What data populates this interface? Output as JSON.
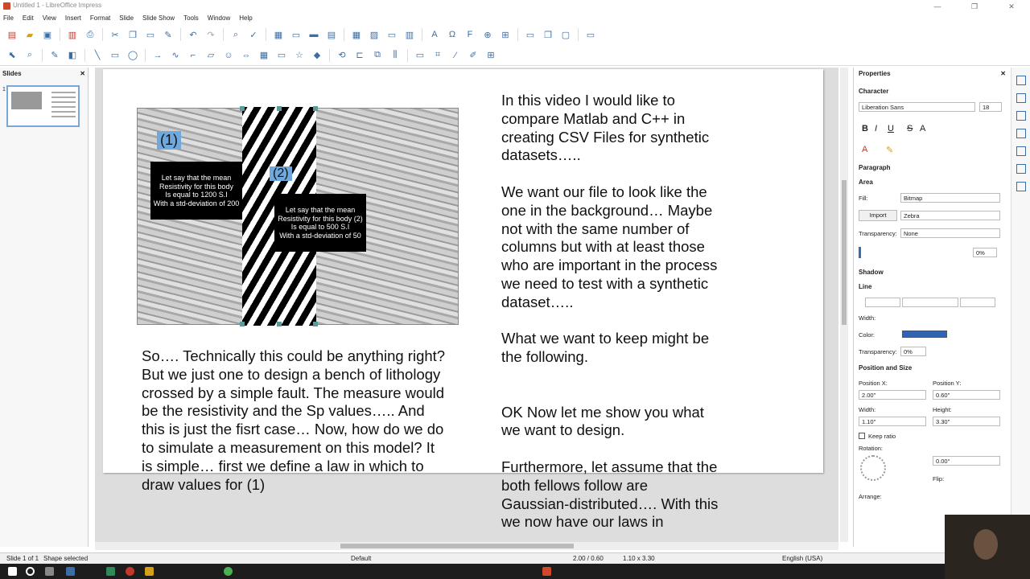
{
  "window": {
    "title": "Untitled 1 - LibreOffice Impress",
    "min": "—",
    "max": "❐",
    "close": "✕"
  },
  "menu": [
    "File",
    "Edit",
    "View",
    "Insert",
    "Format",
    "Slide",
    "Slide Show",
    "Tools",
    "Window",
    "Help"
  ],
  "slides_pane": {
    "title": "Slides",
    "close": "✕",
    "thumb_number": "1"
  },
  "slide": {
    "label1": "(1)",
    "label2": "(2)",
    "box1": [
      "Let say that the mean",
      "Resistivity for this body",
      "Is equal to 1200 S.I",
      "With a std-deviation of 200"
    ],
    "box2": [
      "Let say that the mean",
      "Resistivity for this body (2)",
      "Is equal to 500 S.I",
      "With a std-deviation of 50"
    ],
    "text_left": "So…. Technically this could be anything right? But we just one to design a bench of lithology crossed by a simple fault. The measure would be the resistivity and the Sp values….. And this is just the fisrt case… Now, how do we do to simulate a measurement on this model? It is simple… first we define a law in which to draw values for (1)",
    "text_right": "In this video I would like to compare Matlab and C++ in creating CSV Files for synthetic datasets…..\n\nWe want our file to look like the one in the background… Maybe not with the same number of columns but with at least those who are important in the process we need to test with a synthetic dataset…..\n\nWhat we want to keep might be the following.\n\n\nOK Now let me show you what we want to design.\n\nFurthermore, let assume that the both fellows follow are Gaussian-distributed…. With this we now have our laws in"
  },
  "properties": {
    "title": "Properties",
    "close": "✕",
    "character": {
      "section": "Character",
      "font": "Liberation Sans",
      "size": "18"
    },
    "format_buttons": [
      "B",
      "I",
      "U",
      "S",
      "A"
    ],
    "paragraph": "Paragraph",
    "area": {
      "section": "Area",
      "fill_label": "Fill:",
      "fill_value": "Bitmap",
      "import_label": "Import",
      "bitmap": "Zebra",
      "transparency_label": "Transparency:",
      "transparency_value": "None",
      "percent": "0%"
    },
    "shadow": "Shadow",
    "line": {
      "section": "Line",
      "width_label": "Width:",
      "color_label": "Color:",
      "transparency_label": "Transparency:",
      "transparency_value": "0%"
    },
    "pos_size": {
      "section": "Position and Size",
      "pos_x_label": "Position X:",
      "pos_x": "2.00\"",
      "pos_y_label": "Position Y:",
      "pos_y": "0.60\"",
      "width_label": "Width:",
      "width": "1.10\"",
      "height_label": "Height:",
      "height": "3.30\"",
      "keep_ratio": "Keep ratio",
      "rotation_label": "Rotation:",
      "rotation": "0.00°",
      "flip_label": "Flip:",
      "arrange_label": "Arrange:"
    }
  },
  "status": {
    "slide": "Slide 1 of 1",
    "selection": "Shape selected",
    "layout": "Default",
    "position": "2.00 / 0.60",
    "size": "1.10 x 3.30",
    "language": "English (USA)"
  },
  "colors": {
    "accent": "#3b6ea5",
    "label_bg": "#6fa8dc",
    "line_color": "#2e64b0"
  }
}
